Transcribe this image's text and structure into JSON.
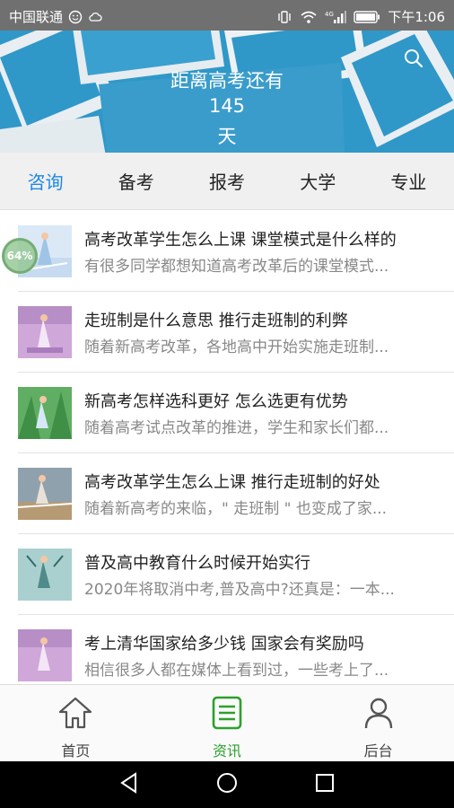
{
  "status_bar": {
    "carrier": "中国联通",
    "time": "下午1:06",
    "network": "4G",
    "icons": [
      "smiley-icon",
      "cloud-icon",
      "vibrate-icon",
      "wifi-icon",
      "signal-icon",
      "battery-icon"
    ]
  },
  "banner": {
    "line1": "距离高考还有",
    "days": "145",
    "unit": "天",
    "search_icon": "search-icon"
  },
  "tabs": [
    {
      "label": "咨询",
      "active": true
    },
    {
      "label": "备考",
      "active": false
    },
    {
      "label": "报考",
      "active": false
    },
    {
      "label": "大学",
      "active": false
    },
    {
      "label": "专业",
      "active": false
    }
  ],
  "progress_badge": "64%",
  "articles": [
    {
      "title": "高考改革学生怎么上课 课堂模式是什么样的",
      "desc": "有很多同学都想知道高考改革后的课堂模式..."
    },
    {
      "title": "走班制是什么意思 推行走班制的利弊",
      "desc": "随着新高考改革，各地高中开始实施走班制..."
    },
    {
      "title": "新高考怎样选科更好 怎么选更有优势",
      "desc": "随着高考试点改革的推进，学生和家长们都..."
    },
    {
      "title": "高考改革学生怎么上课 推行走班制的好处",
      "desc": "随着新高考的来临，\" 走班制 \" 也变成了家..."
    },
    {
      "title": "普及高中教育什么时候开始实行",
      "desc": "2020年将取消中考,普及高中?还真是：一本..."
    },
    {
      "title": "考上清华国家给多少钱 国家会有奖励吗",
      "desc": "相信很多人都在媒体上看到过，一些考上了..."
    }
  ],
  "bottom_nav": [
    {
      "label": "首页",
      "icon": "home-icon",
      "active": false
    },
    {
      "label": "资讯",
      "icon": "news-icon",
      "active": true
    },
    {
      "label": "后台",
      "icon": "user-icon",
      "active": false
    }
  ],
  "colors": {
    "banner_blue": "#2f98c8",
    "tab_active": "#1e88e5",
    "nav_active": "#2da02d"
  }
}
